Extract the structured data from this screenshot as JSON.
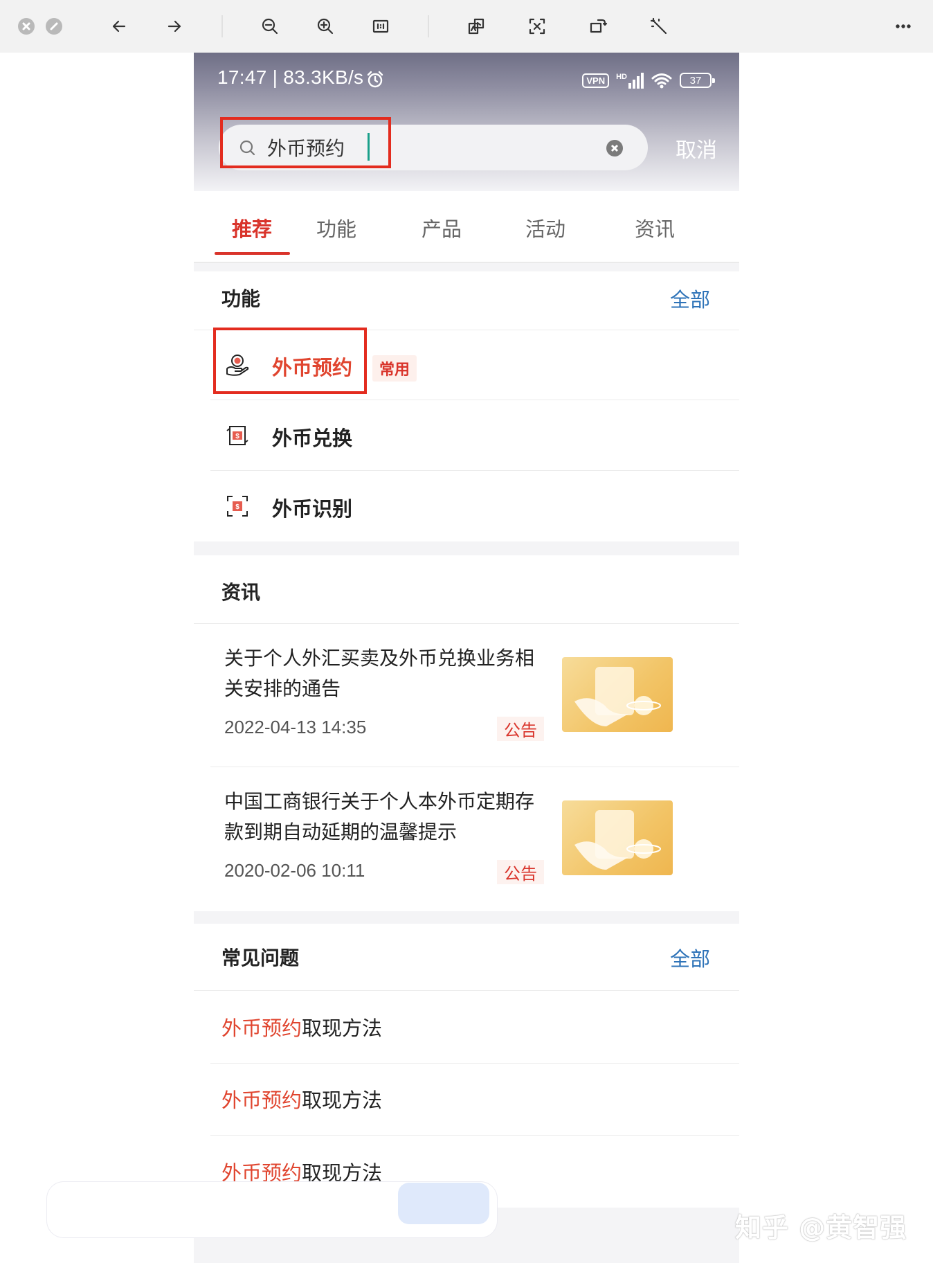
{
  "status_bar": {
    "time_speed": "17:47 | 83.3KB/s",
    "vpn": "VPN",
    "network": "HD",
    "battery": "37"
  },
  "search": {
    "value": "外币预约",
    "cancel_label": "取消"
  },
  "tabs": [
    {
      "label": "推荐",
      "active": true
    },
    {
      "label": "功能",
      "active": false
    },
    {
      "label": "产品",
      "active": false
    },
    {
      "label": "活动",
      "active": false
    },
    {
      "label": "资讯",
      "active": false
    }
  ],
  "functions": {
    "heading": "功能",
    "more": "全部",
    "items": [
      {
        "label": "外币预约",
        "badge": "常用",
        "icon": "hand-coin-icon"
      },
      {
        "label": "外币兑换",
        "icon": "currency-exchange-icon"
      },
      {
        "label": "外币识别",
        "icon": "currency-scan-icon"
      }
    ]
  },
  "news": {
    "heading": "资讯",
    "items": [
      {
        "title": "关于个人外汇买卖及外币兑换业务相关安排的通告",
        "date": "2022-04-13 14:35",
        "tag": "公告"
      },
      {
        "title": "中国工商银行关于个人本外币定期存款到期自动延期的温馨提示",
        "date": "2020-02-06 10:11",
        "tag": "公告"
      }
    ]
  },
  "faq": {
    "heading": "常见问题",
    "more": "全部",
    "items": [
      {
        "keyword": "外币预约",
        "rest": "取现方法"
      },
      {
        "keyword": "外币预约",
        "rest": "取现方法"
      },
      {
        "keyword": "外币预约",
        "rest": "取现方法"
      }
    ]
  },
  "watermark": "知乎 @黄智强",
  "colors": {
    "accent_red": "#d9342b",
    "link_blue": "#2e73b8",
    "highlight_box": "#e32c1f"
  }
}
